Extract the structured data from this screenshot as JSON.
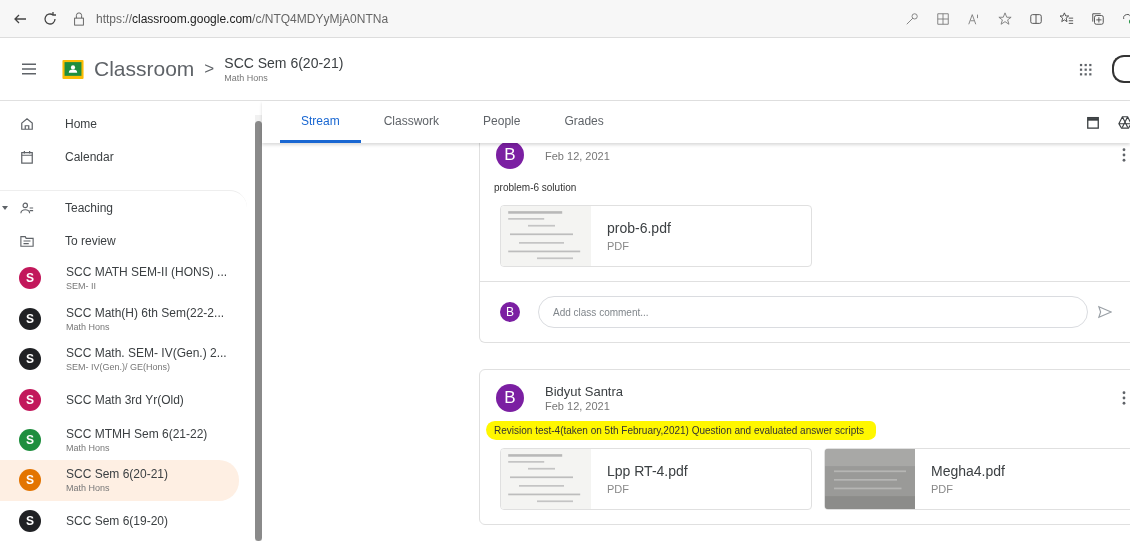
{
  "browser": {
    "url": "https://**classroom.google.com**/c/NTQ4MDYyMjA0NTNa"
  },
  "header": {
    "app_name": "Classroom",
    "separator": ">",
    "class_title": "SCC Sem 6(20-21)",
    "class_subtitle": "Math Hons"
  },
  "sidebar": {
    "items": [
      {
        "kind": "nav",
        "label": "Home",
        "selected": false
      },
      {
        "kind": "nav",
        "label": "Calendar",
        "selected": false
      },
      {
        "kind": "section",
        "label": "Teaching",
        "expanded": true,
        "selected": false
      },
      {
        "kind": "nav",
        "label": "To review",
        "selected": false
      },
      {
        "kind": "class",
        "letter": "S",
        "color": "#c2185b",
        "label": "SCC MATH SEM-II (HONS) ...",
        "subtitle": "SEM- II",
        "selected": false
      },
      {
        "kind": "class",
        "letter": "S",
        "color": "#202124",
        "label": "SCC Math(H) 6th Sem(22-2...",
        "subtitle": "Math Hons",
        "selected": false
      },
      {
        "kind": "class",
        "letter": "S",
        "color": "#202124",
        "label": "SCC Math. SEM- IV(Gen.) 2...",
        "subtitle": "SEM- IV(Gen.)/ GE(Hons)",
        "selected": false
      },
      {
        "kind": "class",
        "letter": "S",
        "color": "#c2185b",
        "label": "SCC Math 3rd Yr(Old)",
        "selected": false
      },
      {
        "kind": "class",
        "letter": "S",
        "color": "#1e8e3e",
        "label": "SCC MTMH Sem 6(21-22)",
        "subtitle": "Math Hons",
        "selected": false
      },
      {
        "kind": "class",
        "letter": "S",
        "color": "#e37400",
        "label": "SCC Sem 6(20-21)",
        "subtitle": "Math Hons",
        "selected": true
      },
      {
        "kind": "class",
        "letter": "S",
        "color": "#202124",
        "label": "SCC Sem 6(19-20)",
        "selected": false
      }
    ]
  },
  "tabs": [
    {
      "label": "Stream",
      "selected": true
    },
    {
      "label": "Classwork",
      "selected": false
    },
    {
      "label": "People",
      "selected": false
    },
    {
      "label": "Grades",
      "selected": false
    }
  ],
  "posts": [
    {
      "avatar": "B",
      "date": "Feb 12, 2021",
      "text": "problem-6 solution",
      "highlighted": false,
      "attachments": [
        {
          "name": "prob-6.pdf",
          "type": "PDF",
          "kind": "picture"
        }
      ],
      "comment": {
        "avatar": "B",
        "placeholder": "Add class comment..."
      }
    },
    {
      "avatar": "B",
      "author": "Bidyut Santra",
      "date": "Feb 12, 2021",
      "text": "Revision test-4(taken on 5th February,2021) Question and evaluated answer scripts",
      "highlighted": true,
      "attachments": [
        {
          "name": "Lpp RT-4.pdf",
          "type": "PDF",
          "kind": "picture"
        },
        {
          "name": "Megha4.pdf",
          "type": "PDF",
          "kind": "picture"
        }
      ]
    }
  ]
}
